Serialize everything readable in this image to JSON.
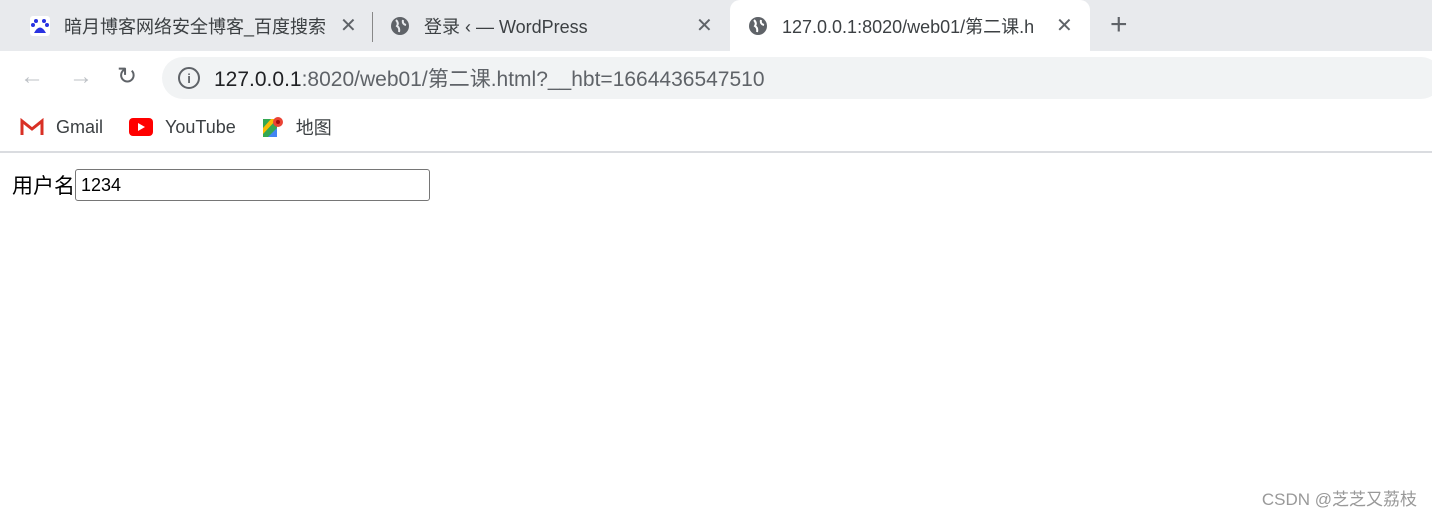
{
  "tabs": [
    {
      "title": "暗月博客网络安全博客_百度搜索",
      "icon": "baidu-icon",
      "active": false
    },
    {
      "title": "登录 ‹ — WordPress",
      "icon": "globe-icon",
      "active": false
    },
    {
      "title": "127.0.0.1:8020/web01/第二课.h",
      "icon": "globe-icon",
      "active": true
    }
  ],
  "toolbar": {
    "url_host": "127.0.0.1",
    "url_rest": ":8020/web01/第二课.html?__hbt=1664436547510"
  },
  "bookmarks": [
    {
      "label": "Gmail",
      "icon": "gmail-icon"
    },
    {
      "label": "YouTube",
      "icon": "youtube-icon"
    },
    {
      "label": "地图",
      "icon": "maps-icon"
    }
  ],
  "page": {
    "username_label": "用户名",
    "username_value": "1234"
  },
  "watermark": "CSDN @芝芝又荔枝"
}
